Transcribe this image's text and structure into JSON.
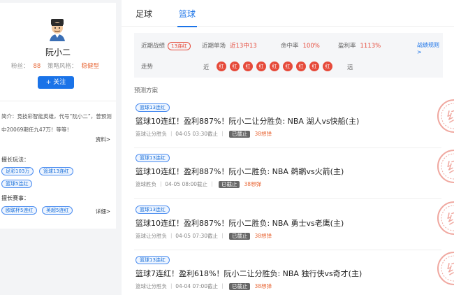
{
  "profile": {
    "name": "阮小二",
    "fans_label": "粉丝：",
    "fans_value": "88",
    "style_label": "策略风格：",
    "style_value": "稳健型",
    "follow_label": "+ 关注",
    "intro": "简介：竞技彩智能英雄，代号“阮小二”，曾预测中20069期任九47万！等等！",
    "intro_more": "资料>",
    "specialty_title": "擅长玩法：",
    "specialty_tags": [
      "足彩103万",
      "篮球13连红",
      "篮球5连红"
    ],
    "event_title": "擅长赛事：",
    "event_tags": [
      "欧联杯5连红",
      "英超5连红"
    ],
    "event_more": "详细>"
  },
  "tabs": [
    "足球",
    "篮球"
  ],
  "summary": {
    "recent_label": "近期战绩",
    "recent_badge": "13连红",
    "single_label": "近期单场",
    "single_value": "近13中13",
    "hit_rate_label": "命中率",
    "hit_rate_value": "100%",
    "profit_label": "盈利率",
    "profit_value": "1113%",
    "rules_link": "战绩规则 >",
    "trend_label": "走势",
    "trend_start": "近",
    "trend_end": "远",
    "trend_dots": [
      "红",
      "红",
      "红",
      "红",
      "红",
      "红",
      "红",
      "红",
      "红"
    ]
  },
  "plans_title": "预测方案",
  "plans": [
    {
      "tag": "篮球13连红",
      "title": "篮球10连红！盈利887%！阮小二让分胜负: NBA 湖人vs快船(主)",
      "meta": "篮球让分胜负 ｜ 04-05 03:30截止 ｜",
      "status": "已截止",
      "hits": "38想弹"
    },
    {
      "tag": "篮球13连红",
      "title": "篮球10连红！盈利887%！阮小二胜负: NBA 鹈鹕vs火箭(主)",
      "meta": "篮球胜负 ｜ 04-05 08:00截止 ｜",
      "status": "已截止",
      "hits": "38想弹"
    },
    {
      "tag": "篮球13连红",
      "title": "篮球10连红！盈利887%！阮小二胜负: NBA 勇士vs老鹰(主)",
      "meta": "篮球让分胜负 ｜ 04-05 07:30截止 ｜",
      "status": "已截止",
      "hits": "38想弹"
    },
    {
      "tag": "篮球13连红",
      "title": "篮球7连红！盈利618%！阮小二让分胜负: NBA 独行侠vs奇才(主)",
      "meta": "篮球让分胜负 ｜ 04-04 07:00截止 ｜",
      "status": "已截止",
      "hits": "38想弹"
    }
  ],
  "stamp_text": "红",
  "colors": {
    "accent": "#1a73e8",
    "red": "#e64a3a",
    "orange": "#e86a3a"
  }
}
